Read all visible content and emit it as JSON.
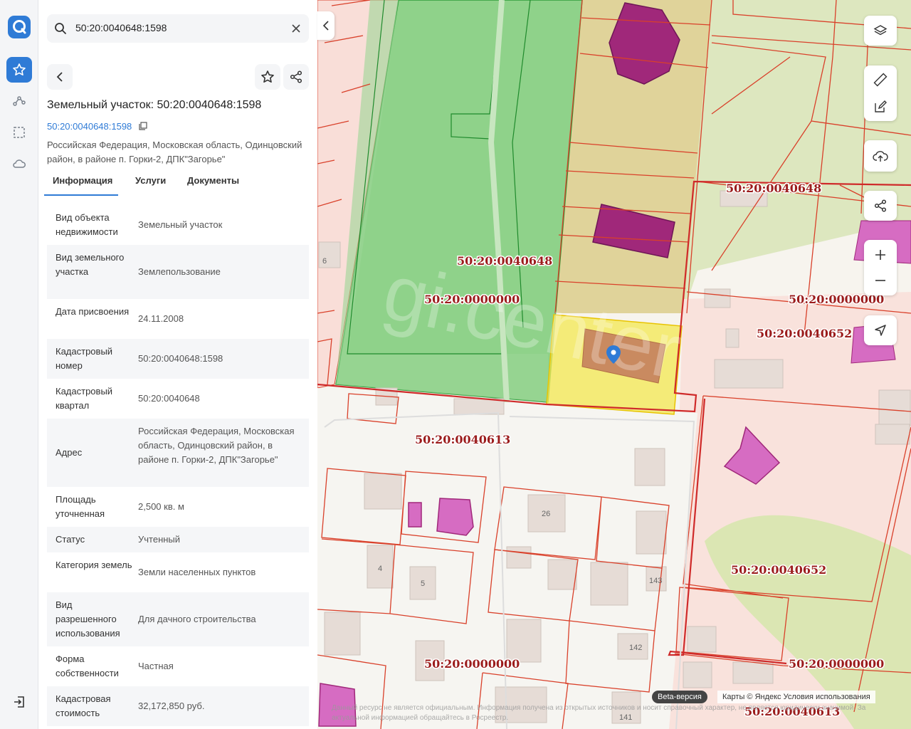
{
  "search": {
    "value": "50:20:0040648:1598"
  },
  "object": {
    "title": "Земельный участок: 50:20:0040648:1598",
    "cad_link": "50:20:0040648:1598",
    "address": "Российская Федерация, Московская область, Одинцовский район, в районе п. Горки-2, ДПК\"Загорье\""
  },
  "tabs": [
    {
      "label": "Информация"
    },
    {
      "label": "Услуги"
    },
    {
      "label": "Документы"
    }
  ],
  "info_rows": [
    {
      "label": "Вид объекта недвижимости",
      "value": "Земельный участок"
    },
    {
      "label": "Вид земельного участка",
      "value": "Землепользование"
    },
    {
      "label": "Дата присвоения",
      "value": "24.11.2008"
    },
    {
      "label": "Кадастровый номер",
      "value": "50:20:0040648:1598"
    },
    {
      "label": "Кадастровый квартал",
      "value": "50:20:0040648"
    },
    {
      "label": "Адрес",
      "value": "Российская Федерация, Московская область, Одинцовский район, в районе п. Горки-2, ДПК\"Загорье\""
    },
    {
      "label": "Площадь уточненная",
      "value": "2,500 кв. м"
    },
    {
      "label": "Статус",
      "value": "Учтенный"
    },
    {
      "label": "Категория земель",
      "value": "Земли населенных пунктов"
    },
    {
      "label": "Вид разрешенного использования",
      "value": "Для дачного строительства"
    },
    {
      "label": "Форма собственности",
      "value": "Частная"
    },
    {
      "label": "Кадастровая стоимость",
      "value": "32,172,850 руб."
    }
  ],
  "map": {
    "quarter_labels": [
      "50:20:0040648",
      "50:20:0040648",
      "50:20:0000000",
      "50:20:0000000",
      "50:20:0040652",
      "50:20:0040613",
      "50:20:0040652",
      "50:20:0000000",
      "50:20:0000000",
      "50:20:0040613"
    ],
    "house_numbers": [
      "6",
      "26",
      "4",
      "5",
      "143",
      "142",
      "141"
    ],
    "watermark": "gi.center",
    "beta": "Beta-версия",
    "attribution": "Карты © Яндекс   Условия использования",
    "disclaimer": "Данный ресурс не является официальным. Информация получена из открытых источников и носит справочный характер, не является юридически значимой. За актуальной информацией обращайтесь в Росреестр."
  },
  "colors": {
    "accent": "#2f7bd6",
    "parcel_border": "#d9402a",
    "selected_fill": "#f2e85a",
    "green": "#8fd28a",
    "building": "#a0287a"
  }
}
